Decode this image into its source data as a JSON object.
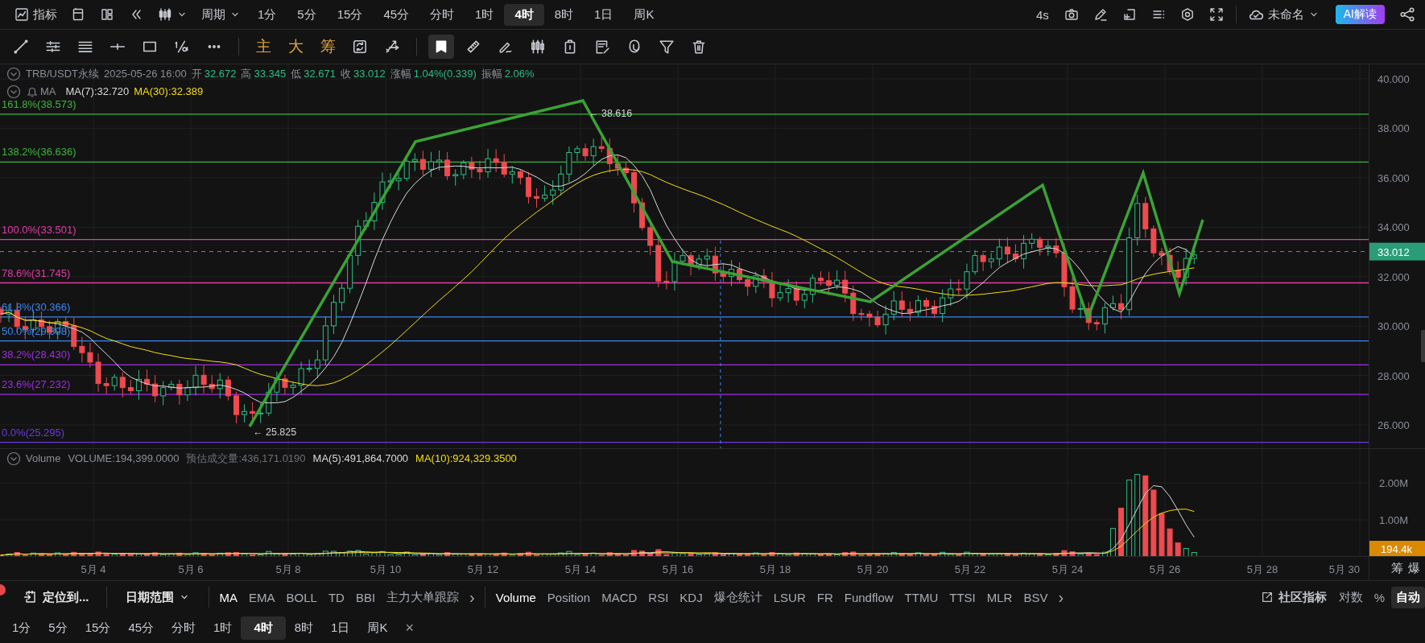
{
  "top_bar": {
    "indicators_button": "指标",
    "period_dropdown": "周期",
    "periods": [
      {
        "label": "1分",
        "selected": false
      },
      {
        "label": "5分",
        "selected": false
      },
      {
        "label": "15分",
        "selected": false
      },
      {
        "label": "45分",
        "selected": false
      },
      {
        "label": "分时",
        "selected": false
      },
      {
        "label": "1时",
        "selected": false
      },
      {
        "label": "4时",
        "selected": true
      },
      {
        "label": "8时",
        "selected": false
      },
      {
        "label": "1日",
        "selected": false
      },
      {
        "label": "周K",
        "selected": false
      }
    ],
    "refresh_interval": "4s",
    "layout_dropdown": "未命名",
    "ai_button": "AI解读"
  },
  "drawing_tools": [
    {
      "kind": "icon",
      "selected": false
    },
    {
      "kind": "icon",
      "selected": false
    },
    {
      "kind": "icon",
      "selected": false
    },
    {
      "kind": "icon",
      "selected": false
    },
    {
      "kind": "icon",
      "selected": false
    },
    {
      "kind": "icon",
      "selected": false
    },
    {
      "kind": "icon",
      "selected": false
    },
    {
      "kind": "separator"
    },
    {
      "kind": "text",
      "label": "主",
      "selected": false
    },
    {
      "kind": "text",
      "label": "大",
      "selected": false
    },
    {
      "kind": "text",
      "label": "筹",
      "selected": false
    },
    {
      "kind": "icon",
      "selected": false
    },
    {
      "kind": "icon",
      "selected": false
    },
    {
      "kind": "separator"
    },
    {
      "kind": "icon",
      "selected": true
    },
    {
      "kind": "icon",
      "selected": false
    },
    {
      "kind": "icon",
      "selected": false
    },
    {
      "kind": "icon",
      "selected": false
    },
    {
      "kind": "icon",
      "selected": false
    },
    {
      "kind": "icon",
      "selected": false
    },
    {
      "kind": "icon",
      "selected": false
    },
    {
      "kind": "icon",
      "selected": false
    },
    {
      "kind": "icon",
      "selected": false
    }
  ],
  "chart": {
    "legend": {
      "symbol": "TRB/USDT永续",
      "datetime": "2025-05-26 16:00",
      "fields": [
        {
          "label": "开",
          "value": "32.672"
        },
        {
          "label": "高",
          "value": "33.345"
        },
        {
          "label": "低",
          "value": "32.671"
        },
        {
          "label": "收",
          "value": "33.012"
        },
        {
          "label": "涨幅",
          "value": "1.04%(0.339)"
        },
        {
          "label": "振幅",
          "value": "2.06%"
        }
      ]
    },
    "ma_legend": {
      "name": "MA",
      "values": [
        {
          "text": "MA(7):32.720",
          "color": "#d9d9d9"
        },
        {
          "text": "MA(30):32.389",
          "color": "#f5dd14"
        }
      ]
    },
    "fib_levels": [
      {
        "label": "161.8%(38.573)",
        "color": "#3cb53c"
      },
      {
        "label": "138.2%(36.636)",
        "color": "#3cb53c"
      },
      {
        "label": "100.0%(33.501)",
        "color": "#e23ba8"
      },
      {
        "label": "78.6%(31.745)",
        "color": "#e23ba8"
      },
      {
        "label": "61.8%(30.366)",
        "color": "#3b86f0"
      },
      {
        "label": "50.0%(29.398)",
        "color": "#3b86f0"
      },
      {
        "label": "38.2%(28.430)",
        "color": "#9d2fe0"
      },
      {
        "label": "23.6%(27.232)",
        "color": "#9d2fe0"
      },
      {
        "label": "0.0%(25.295)",
        "color": "#6a3ae0"
      }
    ],
    "annotations": [
      "← 38.616",
      "← 25.825"
    ],
    "price_axis": [
      "40.000",
      "38.000",
      "36.000",
      "34.000",
      "32.000",
      "30.000",
      "28.000",
      "26.000"
    ],
    "current_price": "33.012",
    "volume_legend": [
      {
        "text": "Volume",
        "color": "#8a8f98"
      },
      {
        "text": "VOLUME:194,399.0000",
        "color": "#8a8f98"
      },
      {
        "text": "预估成交量:436,171.0190",
        "color": "#6b7078"
      },
      {
        "text": "MA(5):491,864.7000",
        "color": "#d9d9d9"
      },
      {
        "text": "MA(10):924,329.3500",
        "color": "#f5dd14"
      }
    ],
    "volume_axis": [
      "2.00M",
      "1.00M"
    ],
    "current_volume": "194.4k",
    "date_axis": [
      "5月 4",
      "5月 6",
      "5月 8",
      "5月 10",
      "5月 12",
      "5月 14",
      "5月 16",
      "5月 18",
      "5月 20",
      "5月 22",
      "5月 24",
      "5月 26",
      "5月 28",
      "5月 30"
    ],
    "axis_buttons": [
      "筹",
      "爆"
    ]
  },
  "indicator_bar": {
    "locate_button": "定位到...",
    "date_range": "日期范围",
    "main_indicators": [
      {
        "label": "MA",
        "selected": true
      },
      {
        "label": "EMA",
        "selected": false
      },
      {
        "label": "BOLL",
        "selected": false
      },
      {
        "label": "TD",
        "selected": false
      },
      {
        "label": "BBI",
        "selected": false
      },
      {
        "label": "主力大单跟踪",
        "selected": false
      }
    ],
    "more_main": "›",
    "sub_indicators": [
      {
        "label": "Volume",
        "selected": true
      },
      {
        "label": "Position",
        "selected": false
      },
      {
        "label": "MACD",
        "selected": false
      },
      {
        "label": "RSI",
        "selected": false
      },
      {
        "label": "KDJ",
        "selected": false
      },
      {
        "label": "爆仓统计",
        "selected": false
      },
      {
        "label": "LSUR",
        "selected": false
      },
      {
        "label": "FR",
        "selected": false
      },
      {
        "label": "Fundflow",
        "selected": false
      },
      {
        "label": "TTMU",
        "selected": false
      },
      {
        "label": "TTSI",
        "selected": false
      },
      {
        "label": "MLR",
        "selected": false
      },
      {
        "label": "BSV",
        "selected": false
      }
    ],
    "more_sub": "›",
    "community": "社区指标",
    "scale_options": [
      {
        "label": "对数",
        "selected": false
      },
      {
        "label": "%",
        "selected": false
      },
      {
        "label": "自动",
        "selected": true
      }
    ]
  },
  "period_bar": {
    "periods": [
      {
        "label": "1分",
        "selected": false
      },
      {
        "label": "5分",
        "selected": false
      },
      {
        "label": "15分",
        "selected": false
      },
      {
        "label": "45分",
        "selected": false
      },
      {
        "label": "分时",
        "selected": false
      },
      {
        "label": "1时",
        "selected": false
      },
      {
        "label": "4时",
        "selected": true
      },
      {
        "label": "8时",
        "selected": false
      },
      {
        "label": "1日",
        "selected": false
      },
      {
        "label": "周K",
        "selected": false
      }
    ],
    "close": "×"
  }
}
